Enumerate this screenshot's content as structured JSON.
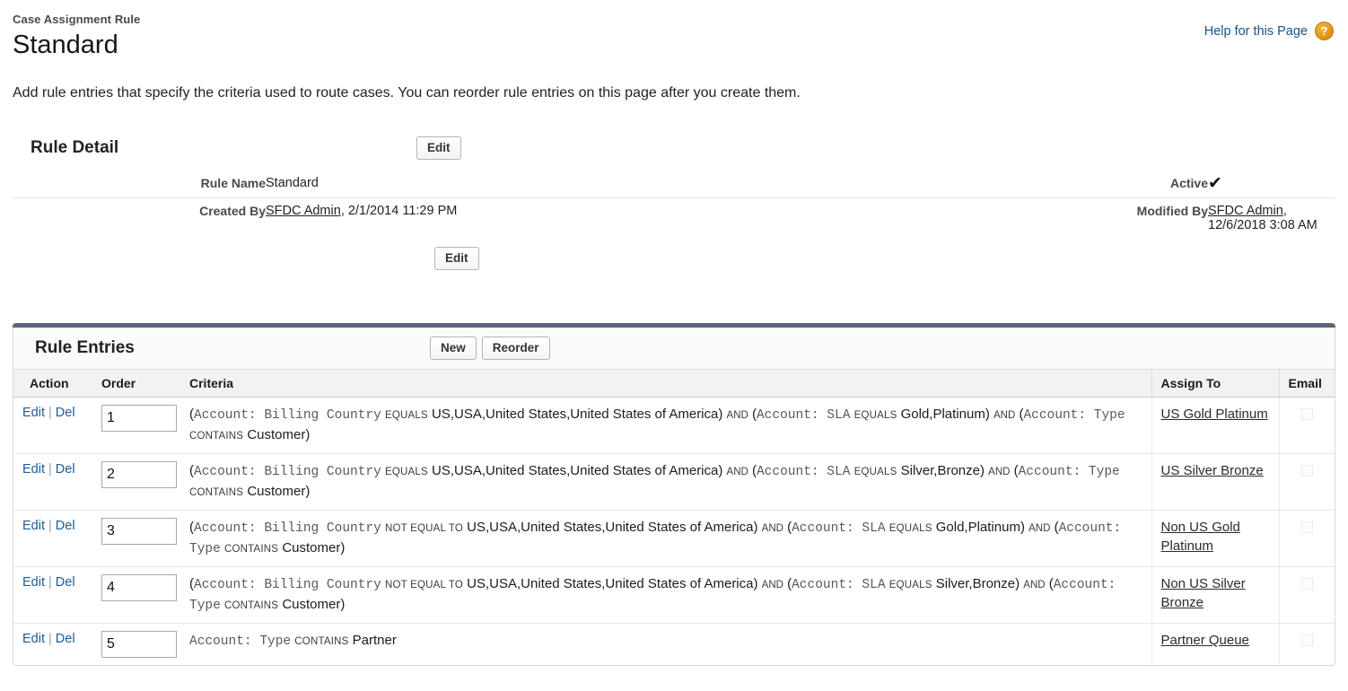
{
  "header": {
    "eyebrow": "Case Assignment Rule",
    "title": "Standard",
    "help_label": "Help for this Page",
    "help_icon_glyph": "?",
    "help_link_color": "#15528f",
    "help_icon_color": "#e09915"
  },
  "intro": "Add rule entries that specify the criteria used to route cases. You can reorder rule entries on this page after you create them.",
  "rule_detail": {
    "section_title": "Rule Detail",
    "edit_top_label": "Edit",
    "edit_bottom_label": "Edit",
    "fields": {
      "rule_name_label": "Rule Name",
      "rule_name_value": "Standard",
      "active_label": "Active",
      "active_checked_glyph": "✔",
      "created_by_label": "Created By",
      "created_by_user": "SFDC Admin",
      "created_by_date": ", 2/1/2014 11:29 PM",
      "modified_by_label": "Modified By",
      "modified_by_user": "SFDC Admin",
      "modified_by_date": ", 12/6/2018 3:08 AM"
    }
  },
  "rule_entries": {
    "section_title": "Rule Entries",
    "new_label": "New",
    "reorder_label": "Reorder",
    "columns": {
      "action": "Action",
      "order": "Order",
      "criteria": "Criteria",
      "assign_to": "Assign To",
      "email": "Email"
    },
    "edit_label": "Edit",
    "del_label": "Del",
    "separator": "|",
    "rows": [
      {
        "order": "1",
        "assign_to": "US Gold Platinum",
        "email_checked": false,
        "criteria_parts": [
          {
            "t": "paren",
            "s": "("
          },
          {
            "t": "fld",
            "s": "Account: Billing Country"
          },
          {
            "t": "op",
            "s": "EQUALS"
          },
          {
            "t": "v",
            "s": "US,USA,United States,United States of America)"
          },
          {
            "t": "conj",
            "s": "AND"
          },
          {
            "t": "paren",
            "s": "("
          },
          {
            "t": "fld",
            "s": "Account: SLA"
          },
          {
            "t": "op",
            "s": "EQUALS"
          },
          {
            "t": "v",
            "s": "Gold,Platinum)"
          },
          {
            "t": "conj",
            "s": "AND"
          },
          {
            "t": "paren",
            "s": "("
          },
          {
            "t": "fld",
            "s": "Account: Type"
          },
          {
            "t": "op",
            "s": "CONTAINS"
          },
          {
            "t": "v",
            "s": "Customer)"
          }
        ]
      },
      {
        "order": "2",
        "assign_to": "US Silver Bronze",
        "email_checked": false,
        "criteria_parts": [
          {
            "t": "paren",
            "s": "("
          },
          {
            "t": "fld",
            "s": "Account: Billing Country"
          },
          {
            "t": "op",
            "s": "EQUALS"
          },
          {
            "t": "v",
            "s": "US,USA,United States,United States of America)"
          },
          {
            "t": "conj",
            "s": "AND"
          },
          {
            "t": "paren",
            "s": "("
          },
          {
            "t": "fld",
            "s": "Account: SLA"
          },
          {
            "t": "op",
            "s": "EQUALS"
          },
          {
            "t": "v",
            "s": "Silver,Bronze)"
          },
          {
            "t": "conj",
            "s": "AND"
          },
          {
            "t": "paren",
            "s": "("
          },
          {
            "t": "fld",
            "s": "Account: Type"
          },
          {
            "t": "op",
            "s": "CONTAINS"
          },
          {
            "t": "v",
            "s": "Customer)"
          }
        ]
      },
      {
        "order": "3",
        "assign_to": "Non US Gold Platinum",
        "email_checked": false,
        "criteria_parts": [
          {
            "t": "paren",
            "s": "("
          },
          {
            "t": "fld",
            "s": "Account: Billing Country"
          },
          {
            "t": "op",
            "s": "NOT EQUAL TO"
          },
          {
            "t": "v",
            "s": "US,USA,United States,United States of America)"
          },
          {
            "t": "conj",
            "s": "AND"
          },
          {
            "t": "paren",
            "s": "("
          },
          {
            "t": "fld",
            "s": "Account: SLA"
          },
          {
            "t": "op",
            "s": "EQUALS"
          },
          {
            "t": "v",
            "s": "Gold,Platinum)"
          },
          {
            "t": "conj",
            "s": "AND"
          },
          {
            "t": "paren",
            "s": "("
          },
          {
            "t": "fld",
            "s": "Account: Type"
          },
          {
            "t": "op",
            "s": "CONTAINS"
          },
          {
            "t": "v",
            "s": "Customer)"
          }
        ]
      },
      {
        "order": "4",
        "assign_to": "Non US Silver Bronze",
        "email_checked": false,
        "criteria_parts": [
          {
            "t": "paren",
            "s": "("
          },
          {
            "t": "fld",
            "s": "Account: Billing Country"
          },
          {
            "t": "op",
            "s": "NOT EQUAL TO"
          },
          {
            "t": "v",
            "s": "US,USA,United States,United States of America)"
          },
          {
            "t": "conj",
            "s": "AND"
          },
          {
            "t": "paren",
            "s": "("
          },
          {
            "t": "fld",
            "s": "Account: SLA"
          },
          {
            "t": "op",
            "s": "EQUALS"
          },
          {
            "t": "v",
            "s": "Silver,Bronze)"
          },
          {
            "t": "conj",
            "s": "AND"
          },
          {
            "t": "paren",
            "s": "("
          },
          {
            "t": "fld",
            "s": "Account: Type"
          },
          {
            "t": "op",
            "s": "CONTAINS"
          },
          {
            "t": "v",
            "s": "Customer)"
          }
        ]
      },
      {
        "order": "5",
        "assign_to": "Partner Queue",
        "email_checked": false,
        "criteria_parts": [
          {
            "t": "fld",
            "s": "Account: Type"
          },
          {
            "t": "op",
            "s": "CONTAINS"
          },
          {
            "t": "v",
            "s": "Partner"
          }
        ]
      }
    ]
  }
}
